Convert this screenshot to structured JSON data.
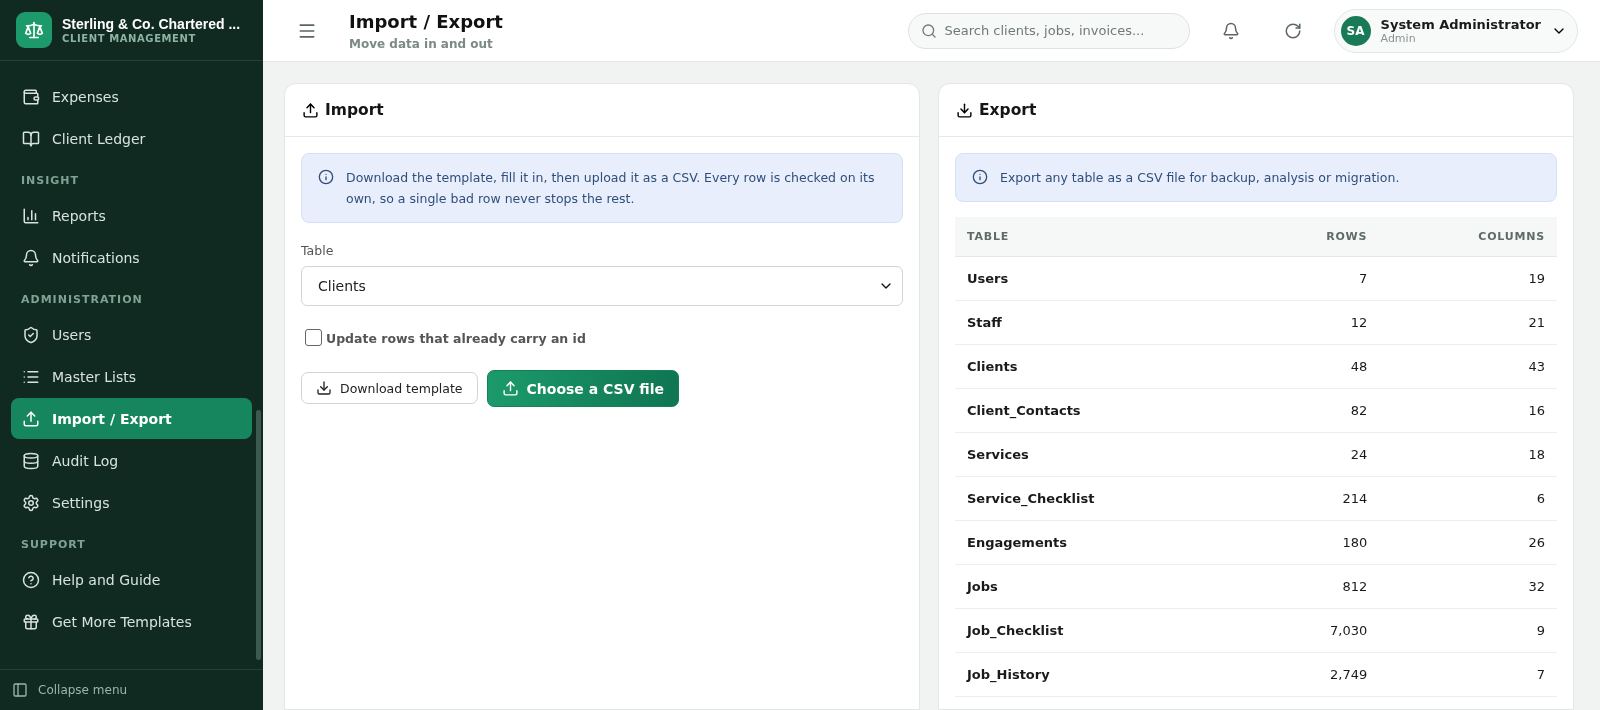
{
  "brand": {
    "name": "Sterling & Co. Chartered ...",
    "subtitle": "CLIENT MANAGEMENT"
  },
  "sidebar": {
    "sections": [
      {
        "items": [
          {
            "label": "Expenses",
            "selected": false
          },
          {
            "label": "Client Ledger",
            "selected": false
          }
        ]
      },
      {
        "heading": "INSIGHT",
        "items": [
          {
            "label": "Reports",
            "selected": false
          },
          {
            "label": "Notifications",
            "selected": false
          }
        ]
      },
      {
        "heading": "ADMINISTRATION",
        "items": [
          {
            "label": "Users",
            "selected": false
          },
          {
            "label": "Master Lists",
            "selected": false
          },
          {
            "label": "Import / Export",
            "selected": true
          },
          {
            "label": "Audit Log",
            "selected": false
          },
          {
            "label": "Settings",
            "selected": false
          }
        ]
      },
      {
        "heading": "SUPPORT",
        "items": [
          {
            "label": "Help and Guide",
            "selected": false
          },
          {
            "label": "Get More Templates",
            "selected": false
          }
        ]
      }
    ],
    "collapse": "Collapse menu"
  },
  "header": {
    "title": "Import / Export",
    "subtitle": "Move data in and out",
    "search": {
      "placeholder": "Search clients, jobs, invoices..."
    },
    "user": {
      "initials": "SA",
      "name": "System Administrator",
      "role": "Admin"
    }
  },
  "import": {
    "title": "Import",
    "info": "Download the template, fill it in, then upload it as a CSV. Every row is checked on its own, so a single bad row never stops the rest.",
    "table_label": "Table",
    "table_value": "Clients",
    "update_existing": {
      "label": "Update rows that already carry an id",
      "checked": false
    },
    "buttons": [
      {
        "label": "Download template",
        "kind": "secondary"
      },
      {
        "label": "Choose a CSV file",
        "kind": "primary"
      }
    ]
  },
  "export": {
    "title": "Export",
    "info": "Export any table as a CSV file for backup, analysis or migration.",
    "columns": [
      "TABLE",
      "ROWS",
      "COLUMNS"
    ],
    "rows": [
      [
        "Users",
        "7",
        "19"
      ],
      [
        "Staff",
        "12",
        "21"
      ],
      [
        "Clients",
        "48",
        "43"
      ],
      [
        "Client_Contacts",
        "82",
        "16"
      ],
      [
        "Services",
        "24",
        "18"
      ],
      [
        "Service_Checklist",
        "214",
        "6"
      ],
      [
        "Engagements",
        "180",
        "26"
      ],
      [
        "Jobs",
        "812",
        "32"
      ],
      [
        "Job_Checklist",
        "7,030",
        "9"
      ],
      [
        "Job_History",
        "2,749",
        "7"
      ]
    ]
  }
}
